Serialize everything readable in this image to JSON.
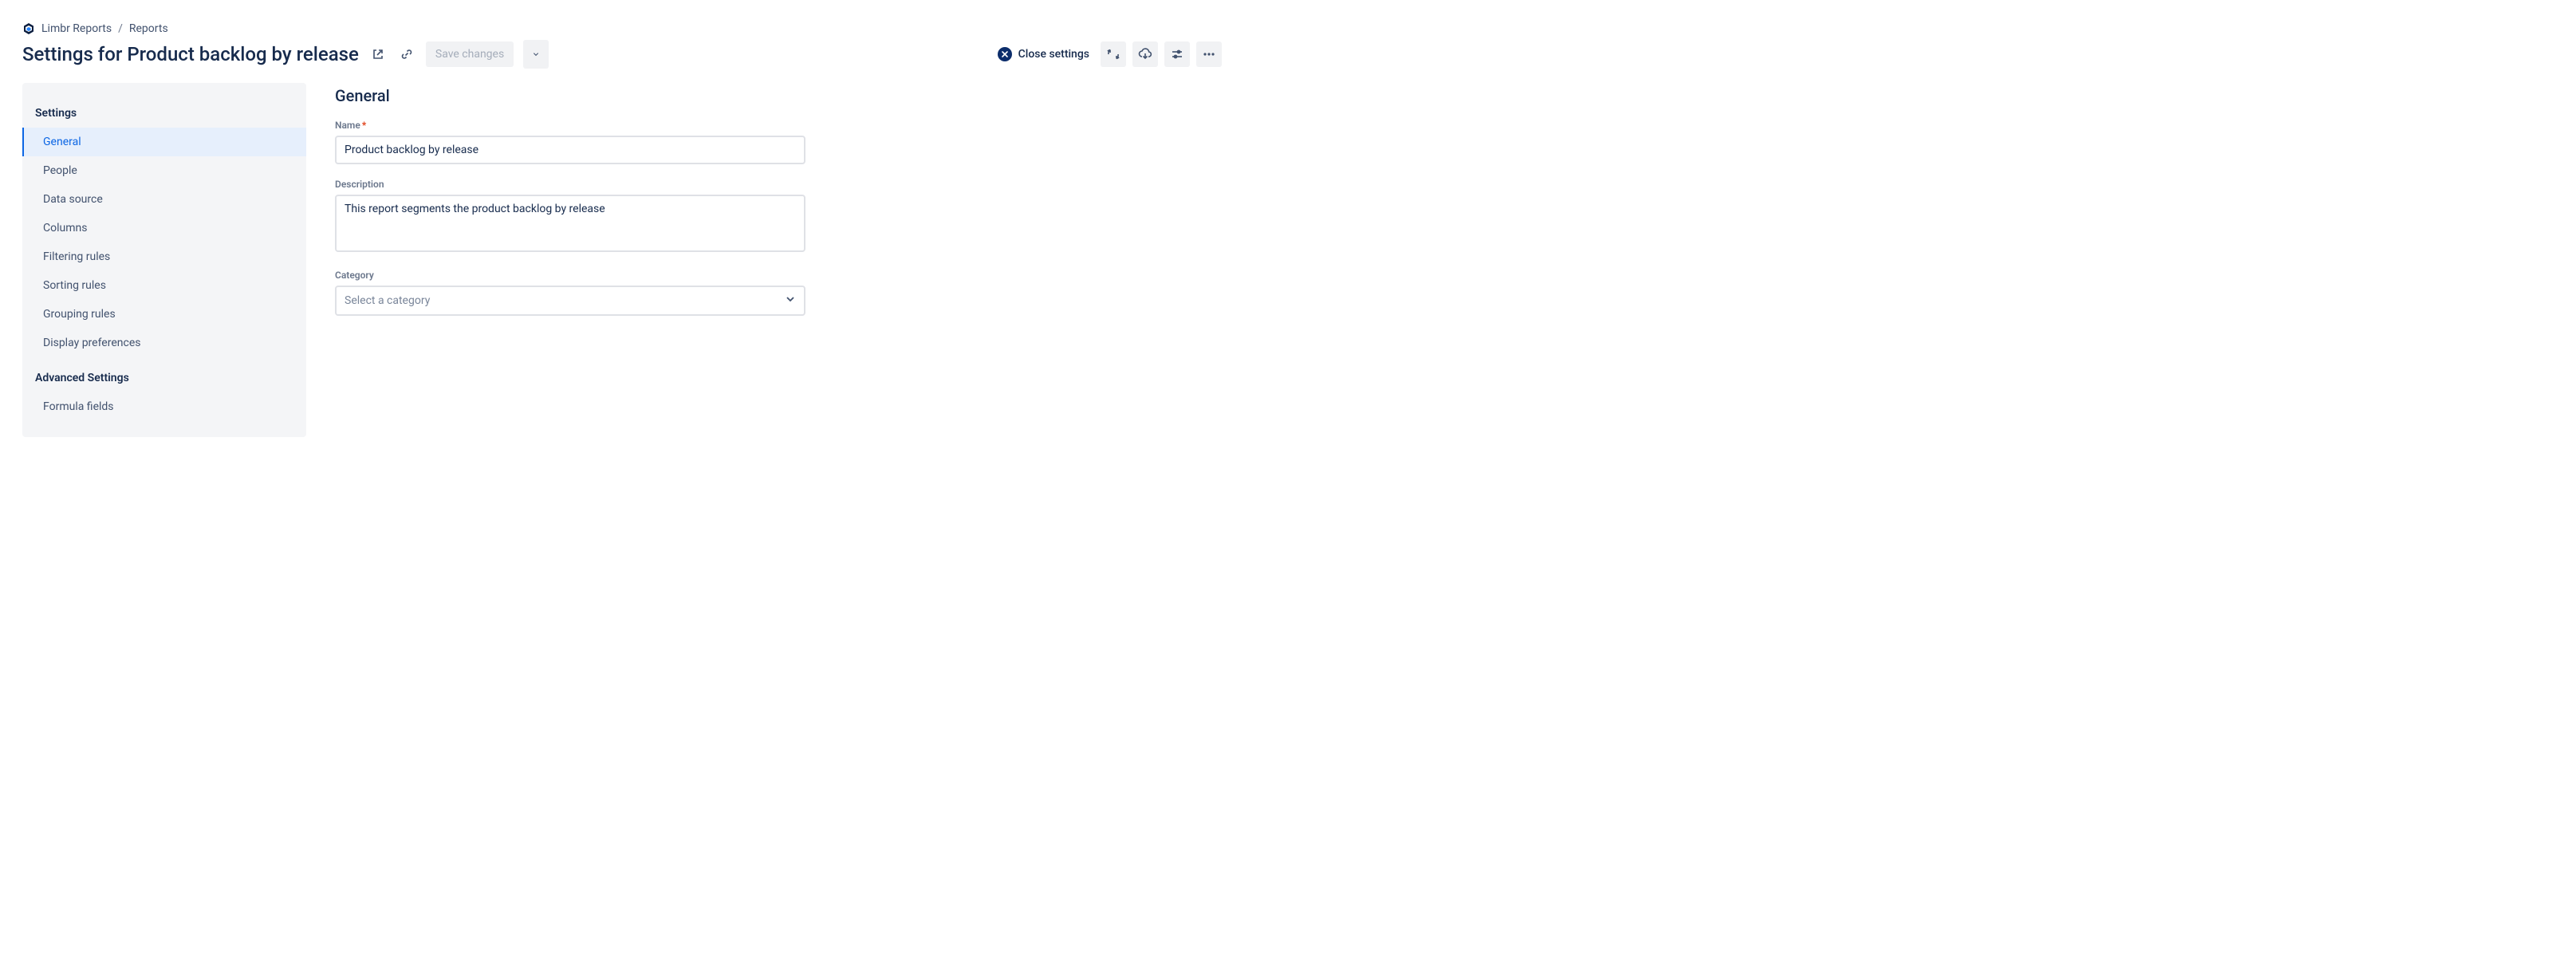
{
  "breadcrumb": {
    "app_name": "Limbr Reports",
    "items": [
      "Reports"
    ]
  },
  "header": {
    "title_prefix": "Settings for ",
    "title_name": "Product backlog by release",
    "save_label": "Save changes",
    "close_label": "Close settings"
  },
  "sidebar": {
    "section1_title": "Settings",
    "items1": [
      "General",
      "People",
      "Data source",
      "Columns",
      "Filtering rules",
      "Sorting rules",
      "Grouping rules",
      "Display preferences"
    ],
    "active_index": 0,
    "section2_title": "Advanced Settings",
    "items2": [
      "Formula fields"
    ]
  },
  "main": {
    "heading": "General",
    "name_label": "Name",
    "name_value": "Product backlog by release",
    "description_label": "Description",
    "description_value": "This report segments the product backlog by release",
    "category_label": "Category",
    "category_placeholder": "Select a category"
  }
}
